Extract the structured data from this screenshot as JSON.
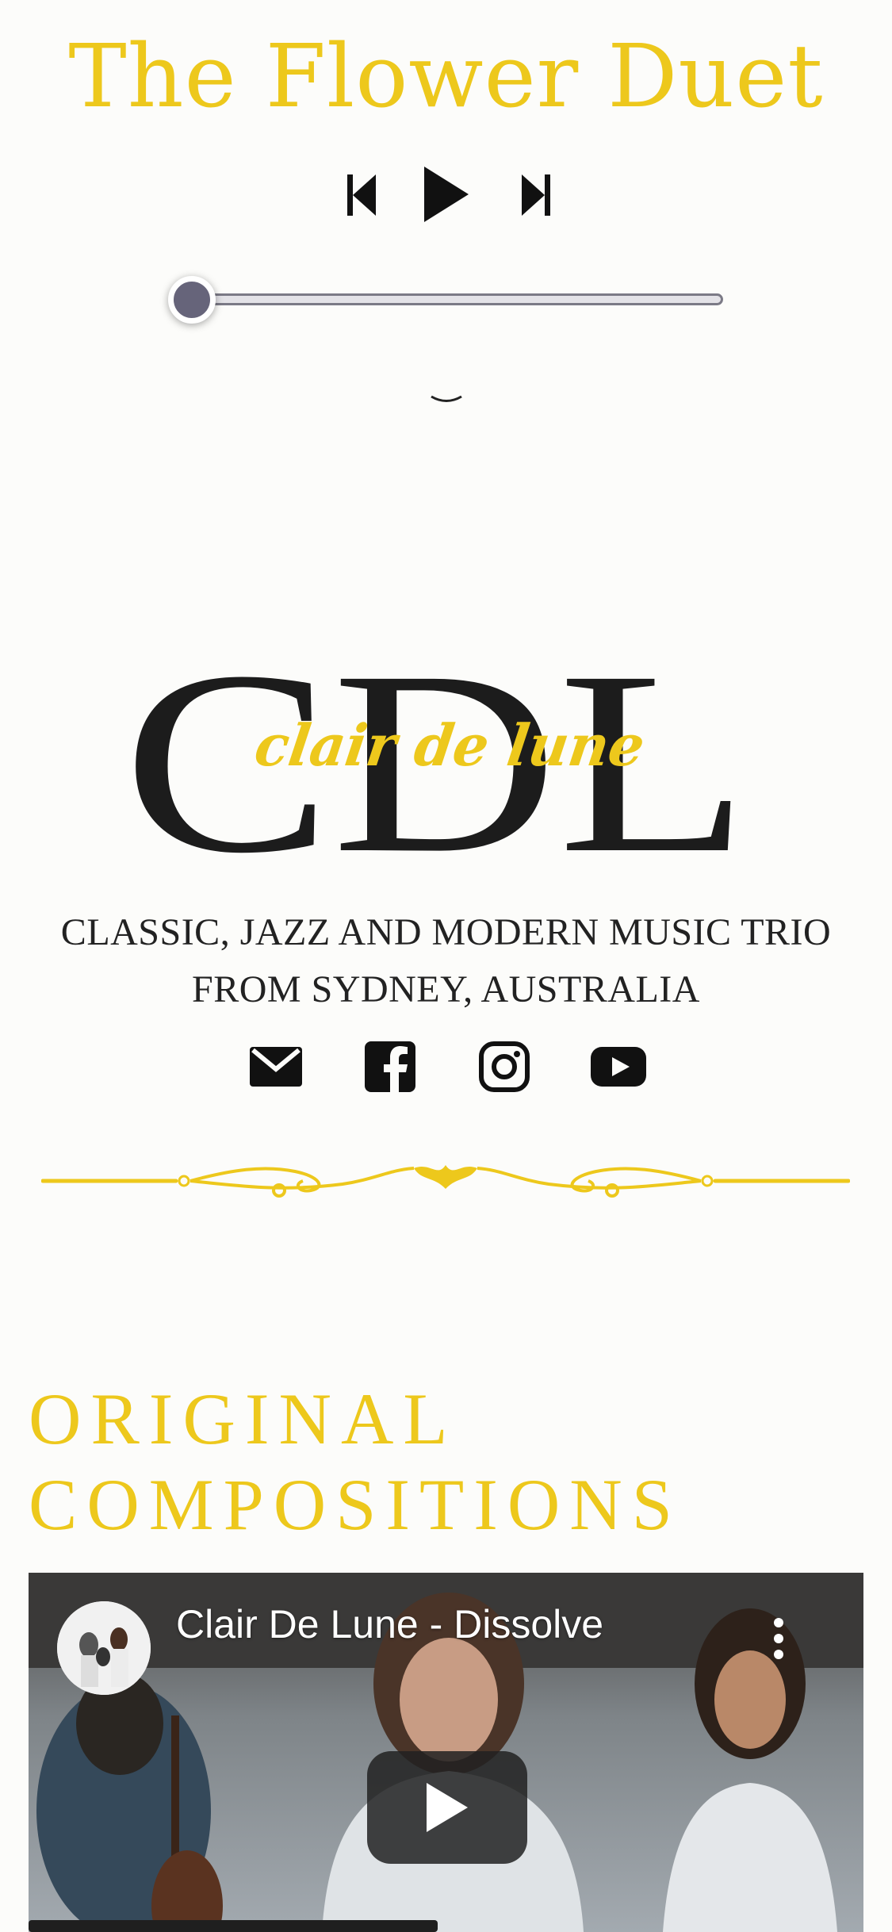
{
  "player": {
    "track_title": "The Flower Duet",
    "progress": 0
  },
  "brand": {
    "logo_letters": "CDL",
    "logo_script": "clair de lune",
    "tagline_line1": "CLASSIC, JAZZ AND MODERN MUSIC TRIO",
    "tagline_line2": "FROM SYDNEY, AUSTRALIA"
  },
  "social": [
    {
      "icon": "mail-icon"
    },
    {
      "icon": "facebook-icon"
    },
    {
      "icon": "instagram-icon"
    },
    {
      "icon": "youtube-icon"
    }
  ],
  "section": {
    "heading_line1": "ORIGINAL",
    "heading_line2": "COMPOSITIONS"
  },
  "video": {
    "title": "Clair De Lune - Dissolve"
  },
  "colors": {
    "accent": "#edc81c",
    "text": "#222222",
    "background": "#fcfcfa"
  }
}
